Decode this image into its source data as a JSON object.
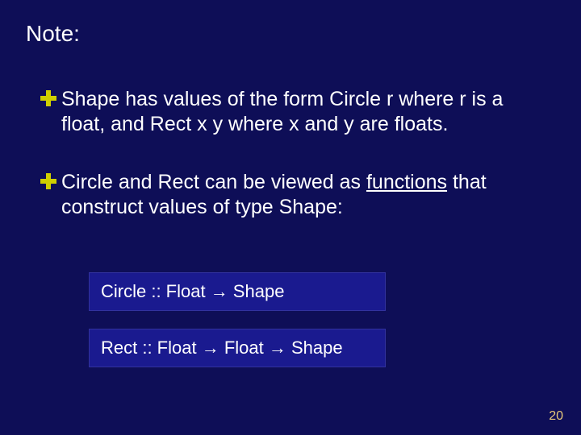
{
  "title": "Note:",
  "bullets": [
    {
      "pre": "Shape has values of the form Circle r where r is a float, and Rect x y where x and y are floats."
    },
    {
      "pre": "Circle and Rect can be viewed as ",
      "u": "functions",
      "post": " that construct values of type Shape:"
    }
  ],
  "code": {
    "line1": "Circle :: Float → Shape",
    "line2": "Rect   :: Float → Float → Shape"
  },
  "page_number": "20"
}
